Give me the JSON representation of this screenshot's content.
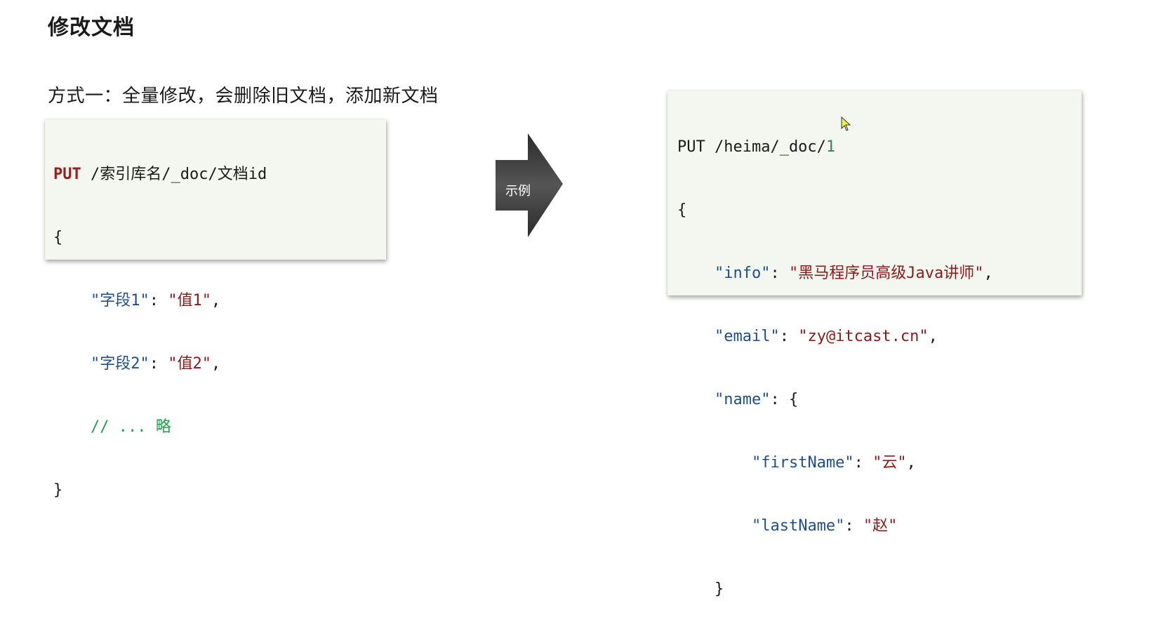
{
  "page": {
    "title": "修改文档",
    "subtitle": "方式一：全量修改，会删除旧文档，添加新文档"
  },
  "syntax_block": {
    "method": "PUT",
    "path": " /索引库名/_doc/文档id",
    "open_brace": "{",
    "field1_key": "\"字段1\"",
    "field1_sep": ": ",
    "field1_value": "\"值1\"",
    "field1_comma": ",",
    "field2_key": "\"字段2\"",
    "field2_sep": ": ",
    "field2_value": "\"值2\"",
    "field2_comma": ",",
    "comment": "// ... 略",
    "close_brace": "}"
  },
  "arrow": {
    "label": "示例",
    "color": "#4a4a4a"
  },
  "example_block": {
    "request_line_prefix": "PUT /heima/_doc/",
    "doc_id": "1",
    "open_brace": "{",
    "info_key": "\"info\"",
    "info_value": "\"黑马程序员高级Java讲师\"",
    "email_key": "\"email\"",
    "email_value": "\"zy@itcast.cn\"",
    "name_key": "\"name\"",
    "name_open": ": {",
    "first_key": "\"firstName\"",
    "first_value": "\"云\"",
    "last_key": "\"lastName\"",
    "last_value": "\"赵\"",
    "name_close": "}",
    "close_brace": "}",
    "sep": ": ",
    "comma": ","
  },
  "colors": {
    "keyword": "#9b1d20",
    "key": "#1f4e8c",
    "string": "#8b1a1a",
    "comment": "#1aa34a",
    "code_bg": "#f3f7ef"
  },
  "icons": {
    "cursor": "mouse-pointer-icon"
  }
}
